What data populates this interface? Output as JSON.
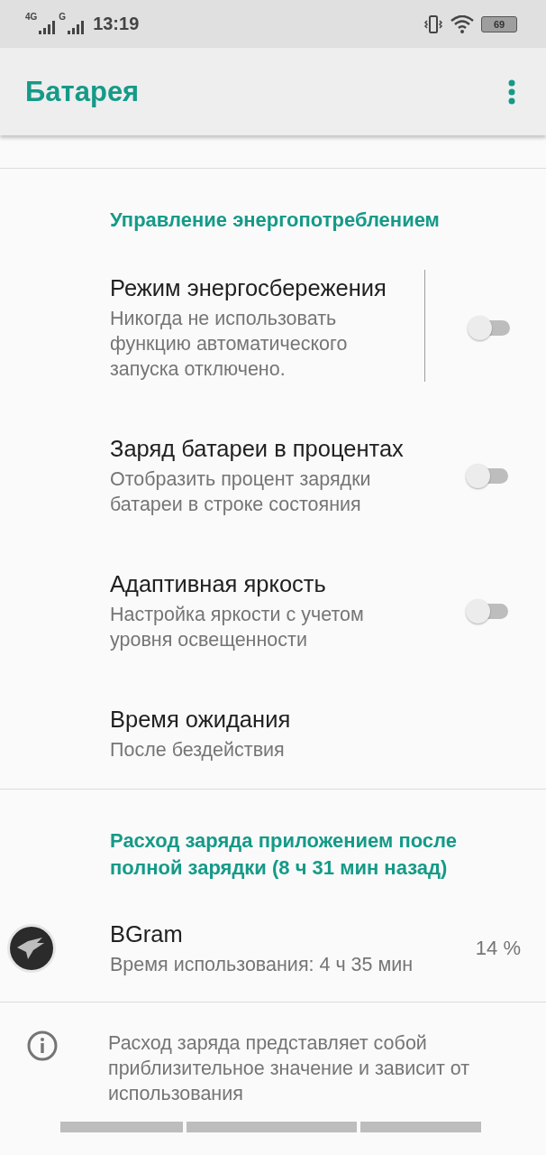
{
  "status_bar": {
    "network_1": "4G",
    "network_2": "G",
    "time": "13:19",
    "battery": "69"
  },
  "app_bar": {
    "title": "Батарея"
  },
  "sections": [
    {
      "header": "Управление энергопотреблением",
      "items": [
        {
          "kind": "switch",
          "title": "Режим энергосбережения",
          "summary": "Никогда не использовать функцию автоматического запуска отключено.",
          "checked": false,
          "separator": true
        },
        {
          "kind": "switch",
          "title": "Заряд батареи в процентах",
          "summary": "Отобразить процент зарядки батареи в строке состояния",
          "checked": false,
          "separator": false
        },
        {
          "kind": "switch",
          "title": "Адаптивная яркость",
          "summary": "Настройка яркости с учетом уровня освещенности",
          "checked": false,
          "separator": false
        },
        {
          "kind": "plain",
          "title": "Время ожидания",
          "summary": "После  бездействия"
        }
      ]
    },
    {
      "header": "Расход заряда приложением после полной зарядки (8 ч 31 мин назад)",
      "items": [
        {
          "kind": "app",
          "title": "BGram",
          "summary": "Время использования: 4 ч 35 мин",
          "value": "14 %"
        }
      ]
    }
  ],
  "footer_note": "Расход заряда представляет собой приблизительное значение и зависит от использования"
}
